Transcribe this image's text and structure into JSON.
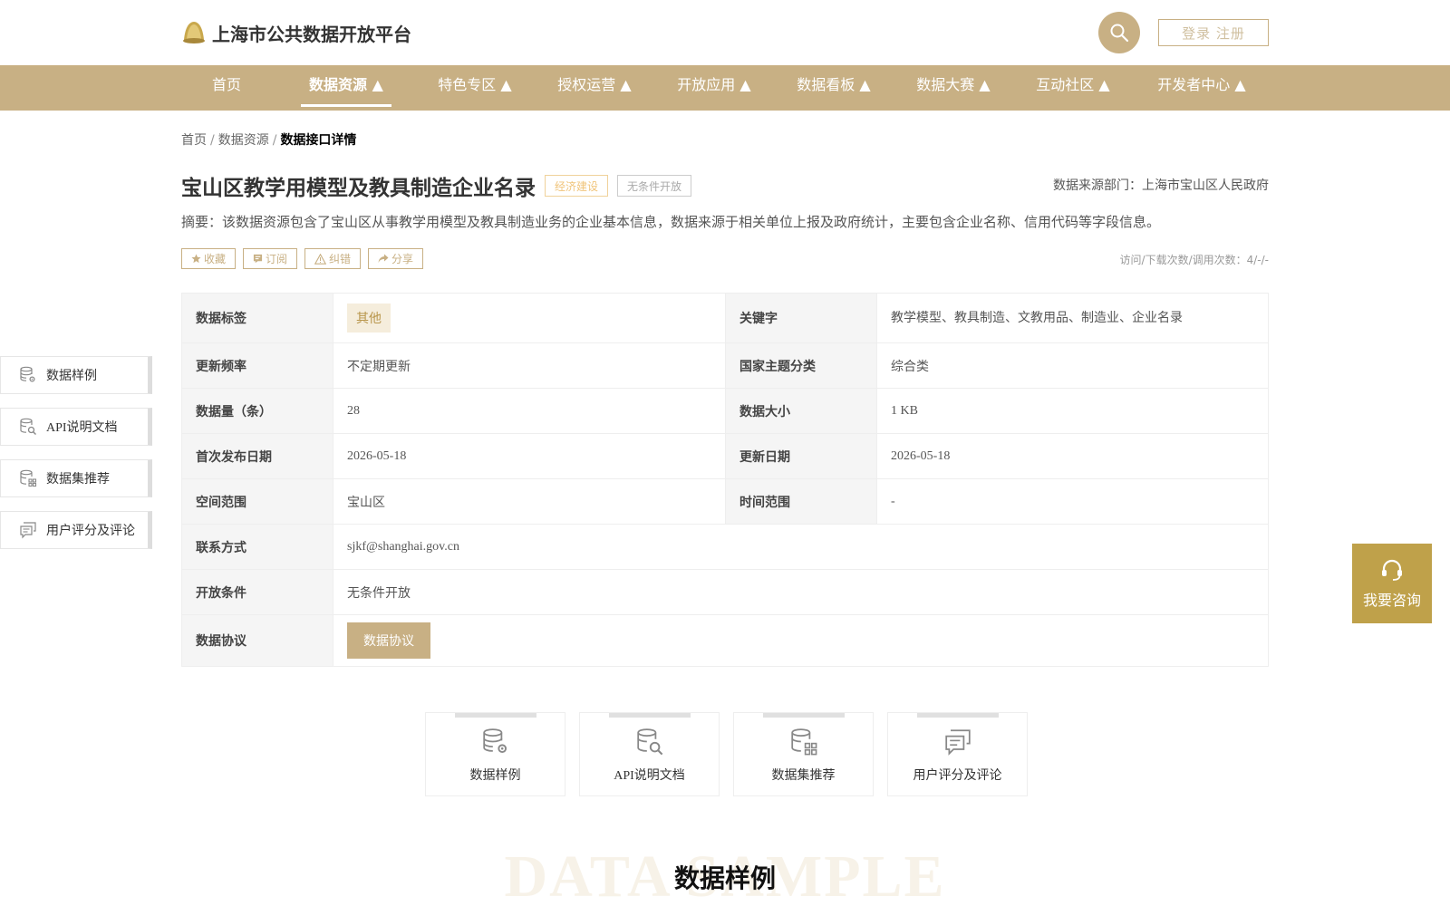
{
  "header": {
    "site_title": "上海市公共数据开放平台",
    "login_label": "登录 注册"
  },
  "nav": {
    "items": [
      {
        "label": "首页"
      },
      {
        "label": "数据资源 ▲"
      },
      {
        "label": "特色专区 ▲"
      },
      {
        "label": "授权运营 ▲"
      },
      {
        "label": "开放应用 ▲"
      },
      {
        "label": "数据看板 ▲"
      },
      {
        "label": "数据大赛 ▲"
      },
      {
        "label": "互动社区 ▲"
      },
      {
        "label": "开发者中心 ▲"
      }
    ],
    "active_index": 1
  },
  "breadcrumb": {
    "home": "首页",
    "section": "数据资源",
    "current": "数据接口详情",
    "separator": "/"
  },
  "dataset": {
    "title": "宝山区教学用模型及教具制造企业名录",
    "tag_category": "经济建设",
    "tag_open": "无条件开放",
    "source": "数据来源部门：上海市宝山区人民政府",
    "summary": "摘要：该数据资源包含了宝山区从事教学用模型及教具制造业务的企业基本信息，数据来源于相关单位上报及政府统计，主要包含企业名称、信用代码等字段信息。",
    "stats": "访问/下载次数/调用次数：4/-/-"
  },
  "actions": {
    "favorite": "收藏",
    "subscribe": "订阅",
    "report": "纠错",
    "share": "分享"
  },
  "info": {
    "label_tag": "数据标签",
    "value_tag": "其他",
    "label_keywords": "关键字",
    "value_keywords": "教学模型、教具制造、文教用品、制造业、企业名录",
    "label_update_freq": "更新频率",
    "value_update_freq": "不定期更新",
    "label_theme": "国家主题分类",
    "value_theme": "综合类",
    "label_count": "数据量（条）",
    "value_count": "28",
    "label_size": "数据大小",
    "value_size": "1 KB",
    "label_first_release": "首次发布日期",
    "value_first_release": "2026-05-18",
    "label_update_date": "更新日期",
    "value_update_date": "2026-05-18",
    "label_space": "空间范围",
    "value_space": "宝山区",
    "label_time": "时间范围",
    "value_time": "-",
    "label_contact": "联系方式",
    "value_contact": "sjkf@shanghai.gov.cn",
    "label_condition": "开放条件",
    "value_condition": "无条件开放",
    "label_protocol": "数据协议",
    "value_protocol_button": "数据协议"
  },
  "side_nav": {
    "items": [
      {
        "label": "数据样例",
        "icon": "database-gear-icon"
      },
      {
        "label": "API说明文档",
        "icon": "database-search-icon"
      },
      {
        "label": "数据集推荐",
        "icon": "database-grid-icon"
      },
      {
        "label": "用户评分及评论",
        "icon": "comments-icon"
      }
    ]
  },
  "consult": {
    "label": "我要咨询"
  },
  "cards": {
    "items": [
      {
        "label": "数据样例"
      },
      {
        "label": "API说明文档"
      },
      {
        "label": "数据集推荐"
      },
      {
        "label": "用户评分及评论"
      }
    ]
  },
  "section": {
    "bg_text": "DATA SAMPLE",
    "title": "数据样例"
  },
  "colors": {
    "brand": "#c8b084",
    "consult": "#bfa14a",
    "tag_econ": "#f0c47a"
  }
}
